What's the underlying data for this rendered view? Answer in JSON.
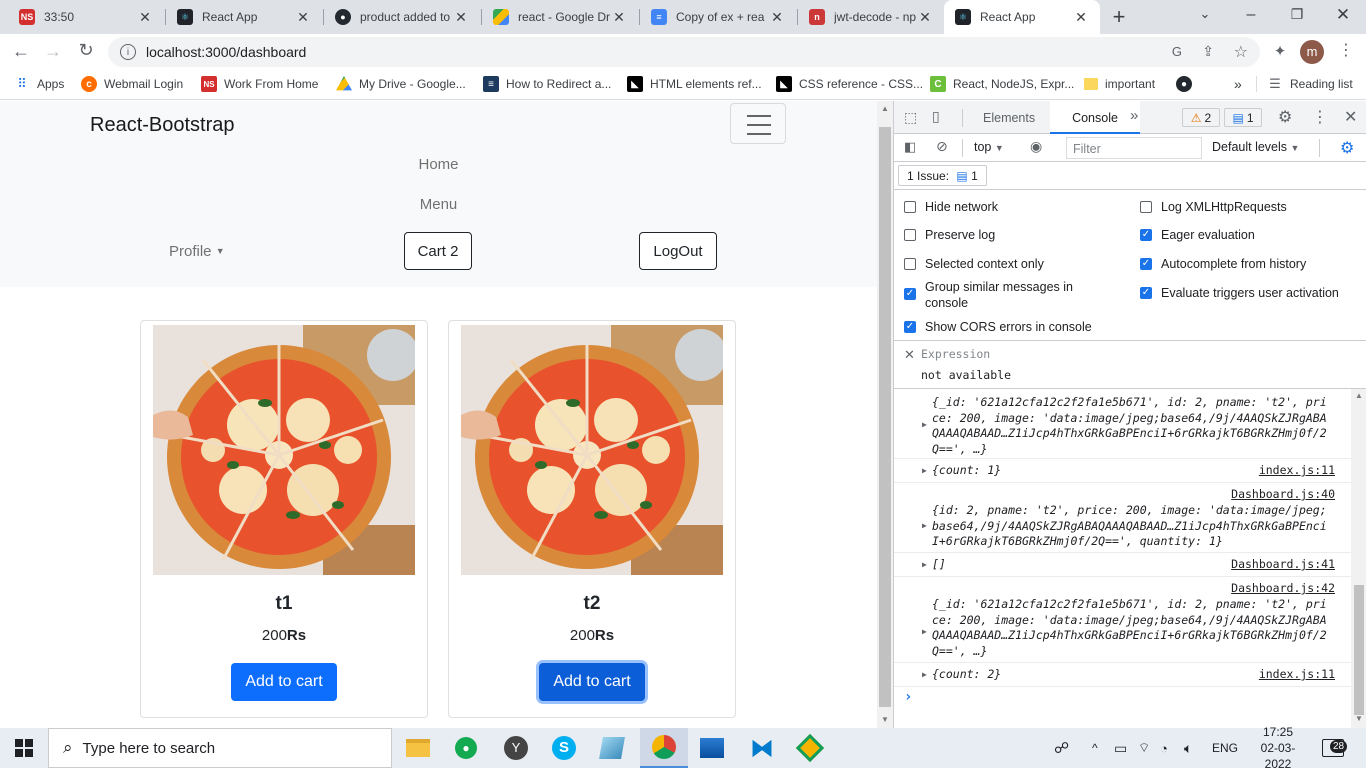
{
  "browser": {
    "tabs": [
      {
        "title": "33:50",
        "icon": "ns-favicon",
        "active": false
      },
      {
        "title": "React App",
        "icon": "react-favicon",
        "active": false
      },
      {
        "title": "product added to",
        "icon": "github-favicon",
        "active": false
      },
      {
        "title": "react - Google Dr",
        "icon": "google-drive-favicon",
        "active": false
      },
      {
        "title": "Copy of ex + rea",
        "icon": "google-docs-favicon",
        "active": false
      },
      {
        "title": "jwt-decode - npm",
        "icon": "npm-favicon",
        "active": false
      },
      {
        "title": "React App",
        "icon": "react-favicon",
        "active": true
      }
    ],
    "url": "localhost:3000/dashboard",
    "profile_initial": "m",
    "bookmarks": [
      {
        "label": "Apps",
        "icon": "apps-grid-icon"
      },
      {
        "label": "Webmail Login",
        "icon": "webmail-icon"
      },
      {
        "label": "Work From Home",
        "icon": "ns-icon"
      },
      {
        "label": "My Drive - Google...",
        "icon": "google-drive-icon"
      },
      {
        "label": "How to Redirect a...",
        "icon": "site-icon"
      },
      {
        "label": "HTML elements ref...",
        "icon": "mdn-icon"
      },
      {
        "label": "CSS reference - CSS...",
        "icon": "mdn-icon"
      },
      {
        "label": "React, NodeJS, Expr...",
        "icon": "site-icon"
      },
      {
        "label": "important",
        "icon": "folder-icon"
      },
      {
        "label": "",
        "icon": "github-icon"
      }
    ],
    "more_bookmarks": "»",
    "reading_list": "Reading list"
  },
  "app": {
    "brand": "React-Bootstrap",
    "nav": {
      "home": "Home",
      "menu": "Menu",
      "profile": "Profile",
      "cart": "Cart 2",
      "logout": "LogOut"
    },
    "products": [
      {
        "name": "t1",
        "price": "200",
        "currency": "Rs",
        "button": "Add to cart"
      },
      {
        "name": "t2",
        "price": "200",
        "currency": "Rs",
        "button": "Add to cart"
      }
    ]
  },
  "devtools": {
    "tabs": {
      "elements": "Elements",
      "console": "Console",
      "more": "»"
    },
    "warnings_count": "2",
    "messages_count": "1",
    "context": "top",
    "filter_placeholder": "Filter",
    "levels": "Default levels",
    "issues_label": "1 Issue:",
    "issues_count": "1",
    "settings": {
      "hide_network": "Hide network",
      "preserve_log": "Preserve log",
      "selected_context": "Selected context only",
      "group_similar": "Group similar messages in console",
      "cors_errors": "Show CORS errors in console",
      "log_xhr": "Log XMLHttpRequests",
      "eager_eval": "Eager evaluation",
      "autocomplete": "Autocomplete from history",
      "eval_triggers": "Evaluate triggers user activation"
    },
    "expression_label": "Expression",
    "expression_value": "not available",
    "log": [
      {
        "src": "",
        "text": "{_id: '621a12cfa12c2f2fa1e5b671', id: 2, pname: 't2', price: 200, image: 'data:image/jpeg;base64,/9j/4AAQSkZJRgABAQAAAQABAAD…Z1iJcp4hThxGRkGaBPEnciI+6rGRkajkT6BGRkZHmj0f/2Q==', …}"
      },
      {
        "src": "index.js:11",
        "text": "{count: 1}"
      },
      {
        "src": "Dashboard.js:40",
        "text": "{id: 2, pname: 't2', price: 200, image: 'data:image/jpeg;base64,/9j/4AAQSkZJRgABAQAAAQABAAD…Z1iJcp4hThxGRkGaBPEnciI+6rGRkajkT6BGRkZHmj0f/2Q==', quantity: 1}"
      },
      {
        "src": "Dashboard.js:41",
        "text": "[]"
      },
      {
        "src": "Dashboard.js:42",
        "text": "{_id: '621a12cfa12c2f2fa1e5b671', id: 2, pname: 't2', price: 200, image: 'data:image/jpeg;base64,/9j/4AAQSkZJRgABAQAAAQABAAD…Z1iJcp4hThxGRkGaBPEnciI+6rGRkajkT6BGRkZHmj0f/2Q==', …}"
      },
      {
        "src": "index.js:11",
        "text": "{count: 2}"
      }
    ],
    "prompt": "›"
  },
  "taskbar": {
    "search_placeholder": "Type here to search",
    "language": "ENG",
    "time": "17:25",
    "date": "02-03-2022",
    "notifications": "28"
  }
}
